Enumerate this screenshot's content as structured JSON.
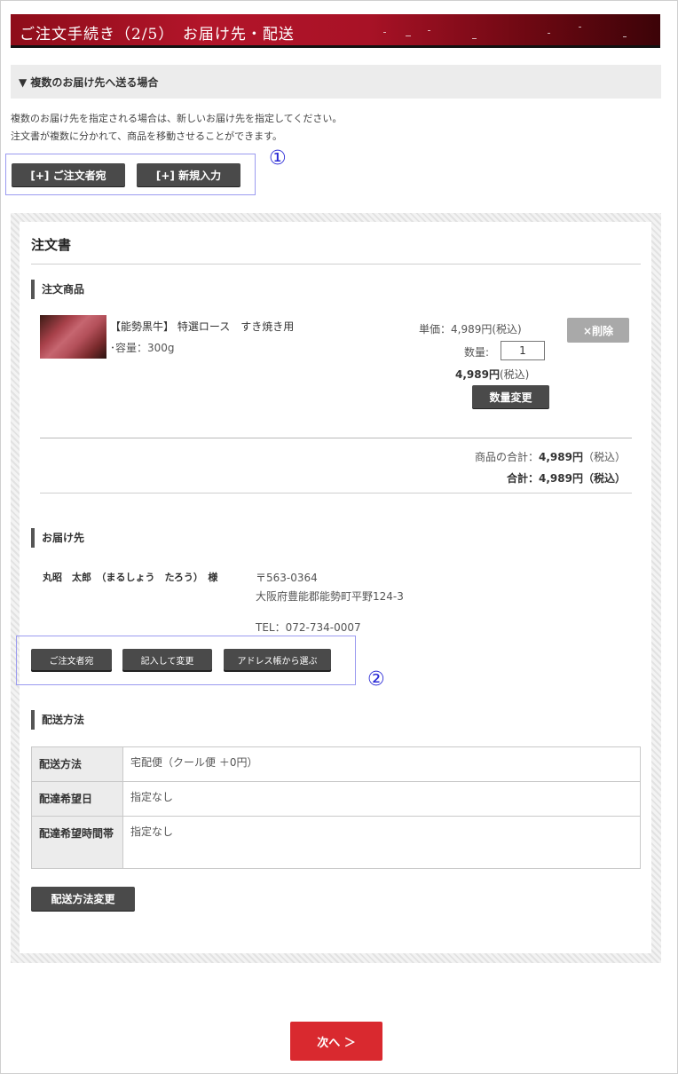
{
  "header": {
    "title": "ご注文手続き（2/5）　お届け先・配送"
  },
  "multi_destination": {
    "heading": "▼ 複数のお届け先へ送る場合",
    "line1": "複数のお届け先を指定される場合は、新しいお届け先を指定してください。",
    "line2": "注文書が複数に分かれて、商品を移動させることができます。",
    "add_orderer_label": "[+] ご注文者宛",
    "add_new_label": "[+] 新規入力",
    "annotation_1": "①"
  },
  "order": {
    "title": "注文書",
    "items_heading": "注文商品",
    "item": {
      "image": "beef-thumbnail",
      "name": "【能勢黒牛】 特選ロース　すき焼き用",
      "option": "･容量：300g",
      "unit_price": "単価：4,989円(税込)",
      "qty_label": "数量:",
      "qty_value": "1",
      "line_total": "4,989円",
      "line_total_tax": "(税込)",
      "delete_label": "×削除",
      "change_qty_label": "数量変更"
    },
    "subtotal_label": "商品の合計：",
    "subtotal_value": "4,989円",
    "subtotal_tax": "（税込）",
    "total_label": "合計：",
    "total_value": "4,989円",
    "total_tax": "（税込）"
  },
  "delivery": {
    "heading": "お届け先",
    "recipient": "丸昭　太郎　（まるしょう　たろう）　様",
    "postal": "〒563-0364",
    "address": "大阪府豊能郡能勢町平野124-3",
    "tel": "TEL：072-734-0007",
    "btn_orderer": "ご注文者宛",
    "btn_edit": "記入して変更",
    "btn_addressbook": "アドレス帳から選ぶ",
    "annotation_2": "②"
  },
  "shipping": {
    "heading": "配送方法",
    "rows": [
      {
        "label": "配送方法",
        "value": "宅配便（クール便 ＋0円）"
      },
      {
        "label": "配達希望日",
        "value": "指定なし"
      },
      {
        "label": "配達希望時間帯",
        "value": "指定なし"
      }
    ],
    "change_label": "配送方法変更"
  },
  "footer": {
    "next_label": "次へ ＞"
  },
  "colors": {
    "banner": "#a81226",
    "next_button": "#d9292f",
    "dark_button": "#4a4a4a",
    "annotation": "#2b2bd6"
  }
}
